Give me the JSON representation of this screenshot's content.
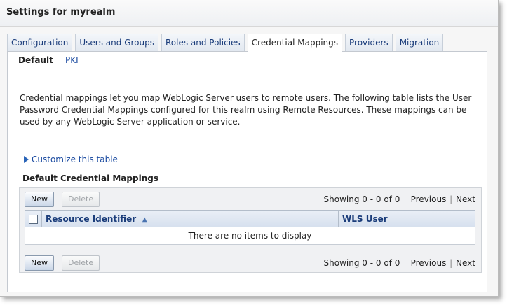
{
  "page_title": "Settings for myrealm",
  "tabs": [
    {
      "label": "Configuration",
      "active": false
    },
    {
      "label": "Users and Groups",
      "active": false
    },
    {
      "label": "Roles and Policies",
      "active": false
    },
    {
      "label": "Credential Mappings",
      "active": true
    },
    {
      "label": "Providers",
      "active": false
    },
    {
      "label": "Migration",
      "active": false
    }
  ],
  "subtabs": {
    "default_label": "Default",
    "pki_label": "PKI"
  },
  "description": "Credential mappings let you map WebLogic Server users to remote users. The following table lists the User Password Credential Mappings configured for this realm using Remote Resources. These mappings can be used by any WebLogic Server application or service.",
  "customize_link": "Customize this table",
  "section_title": "Default Credential Mappings",
  "toolbar": {
    "new_label": "New",
    "delete_label": "Delete"
  },
  "pager": {
    "showing": "Showing 0 - 0 of 0",
    "previous": "Previous",
    "separator": "|",
    "next": "Next"
  },
  "table": {
    "col_resource": "Resource Identifier",
    "col_user": "WLS User",
    "empty_message": "There are no items to display"
  },
  "colors": {
    "link": "#1a4aa0",
    "header_text": "#1a3c7a"
  }
}
